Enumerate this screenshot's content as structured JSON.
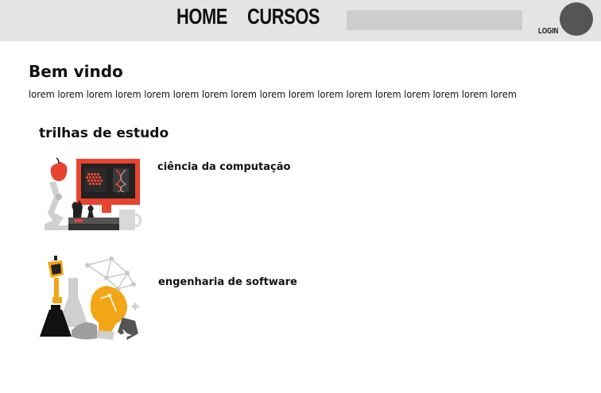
{
  "header": {
    "nav": [
      {
        "label": "HOME"
      },
      {
        "label": "CURSOS"
      }
    ],
    "search": {
      "value": "",
      "placeholder": ""
    },
    "login_label": "LOGIN"
  },
  "main": {
    "title": "Bem vindo",
    "description": "lorem lorem lorem lorem lorem lorem lorem lorem lorem lorem lorem lorem lorem lorem lorem lorem lorem",
    "section_title": "trilhas de estudo",
    "tracks": [
      {
        "label": "ciência da computação",
        "icon": "computer-science-illustration"
      },
      {
        "label": "engenharia de software",
        "icon": "software-engineering-illustration"
      }
    ]
  },
  "colors": {
    "header_bg": "#e4e4e4",
    "search_bg": "#cdcdcd",
    "avatar": "#555555",
    "accent_red": "#e8432f",
    "accent_yellow": "#f2a516"
  }
}
